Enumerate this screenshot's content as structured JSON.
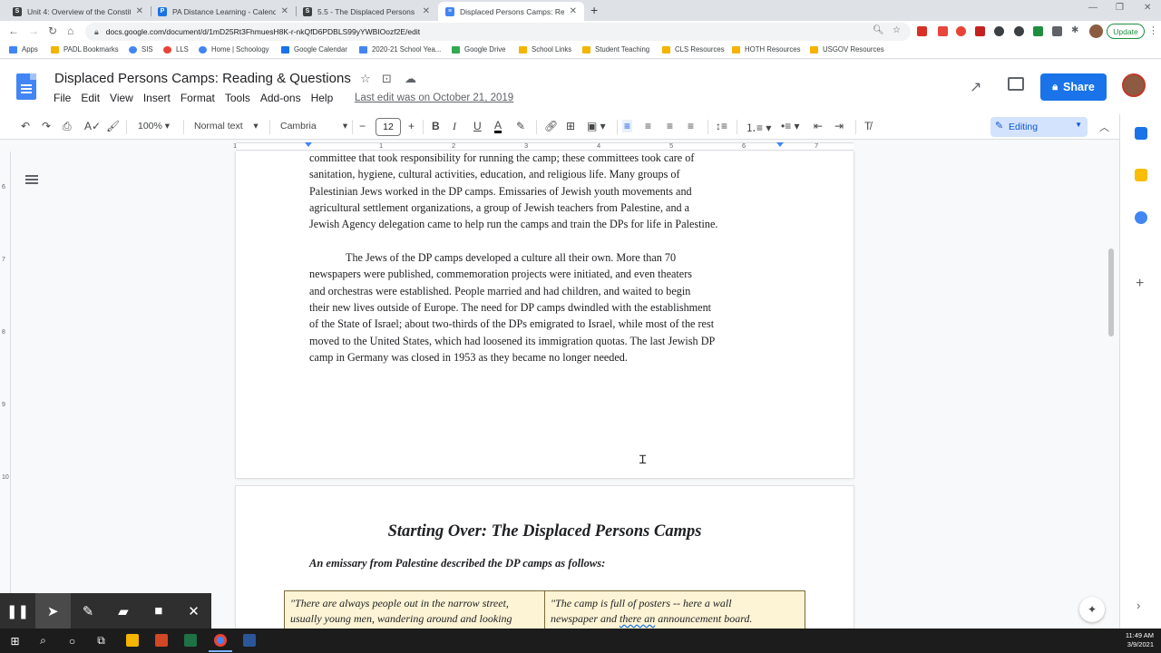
{
  "browser": {
    "tabs": [
      {
        "title": "Unit 4: Overview of the Constitu",
        "color": "#3c4043",
        "glyph": "S"
      },
      {
        "title": "PA Distance Learning - Calendar",
        "color": "#1a73e8",
        "glyph": "P"
      },
      {
        "title": "5.5 - The Displaced Persons Camp",
        "color": "#3c4043",
        "glyph": "S"
      },
      {
        "title": "Displaced Persons Camps: Readi",
        "color": "#4285f4",
        "glyph": "≡"
      }
    ],
    "url": "docs.google.com/document/d/1mD25Rt3FhmuesH8K-r-nkQfD6PDBLS99yYWBIOozf2E/edit",
    "update_label": "Update",
    "bookmarks": [
      "Apps",
      "PADL Bookmarks",
      "SIS",
      "LLS",
      "Home | Schoology",
      "Google Calendar",
      "2020-21 School Yea...",
      "Google Drive",
      "School Links",
      "Student Teaching",
      "CLS Resources",
      "HOTH Resources",
      "USGOV Resources"
    ]
  },
  "docs": {
    "title": "Displaced Persons Camps: Reading & Questions",
    "menu": [
      "File",
      "Edit",
      "View",
      "Insert",
      "Format",
      "Tools",
      "Add-ons",
      "Help"
    ],
    "last_edit": "Last edit was on October 21, 2019",
    "share_label": "Share",
    "toolbar": {
      "zoom": "100%",
      "style": "Normal text",
      "font": "Cambria",
      "font_size": "12",
      "mode": "Editing"
    },
    "ruler_numbers": [
      "1",
      "1",
      "2",
      "3",
      "4",
      "5",
      "6",
      "7"
    ],
    "vruler_numbers": [
      "6",
      "7",
      "8",
      "9",
      "10"
    ]
  },
  "document": {
    "para1_lines": [
      "committee that took responsibility for running the camp; these committees took care of",
      "sanitation, hygiene, cultural activities, education, and religious life. Many groups of",
      "Palestinian Jews worked in the DP camps. Emissaries of Jewish youth movements and",
      "agricultural settlement organizations, a group of Jewish teachers from Palestine, and a",
      "Jewish Agency delegation came to help run the camps and train the DPs for life in Palestine."
    ],
    "para2_lines": [
      "The Jews of the DP camps developed a culture all their own. More than 70",
      "newspapers were published, commemoration projects were initiated, and even theaters",
      "and orchestras were established. People married and had children, and waited to begin",
      "their new lives outside of Europe. The need for DP camps dwindled with the establishment",
      "of the State of Israel; about two-thirds of the DPs emigrated to Israel, while most of the rest",
      "moved to the United States, which had loosened its immigration quotas. The last Jewish DP",
      "camp in Germany was closed in 1953 as they became no longer needed."
    ],
    "heading": "Starting Over: The Displaced Persons Camps",
    "intro": "An emissary from Palestine described the DP camps as follows:",
    "quote_left": [
      "\"There are always people out in the narrow street,",
      "usually young men, wandering around and looking"
    ],
    "quote_right_a": "\"The camp is full of posters -- here a wall",
    "quote_right_b1": "newspaper and ",
    "quote_right_b2": "there an",
    "quote_right_b3": " announcement board."
  },
  "taskbar": {
    "time": "11:49 AM",
    "date": "3/9/2021"
  }
}
